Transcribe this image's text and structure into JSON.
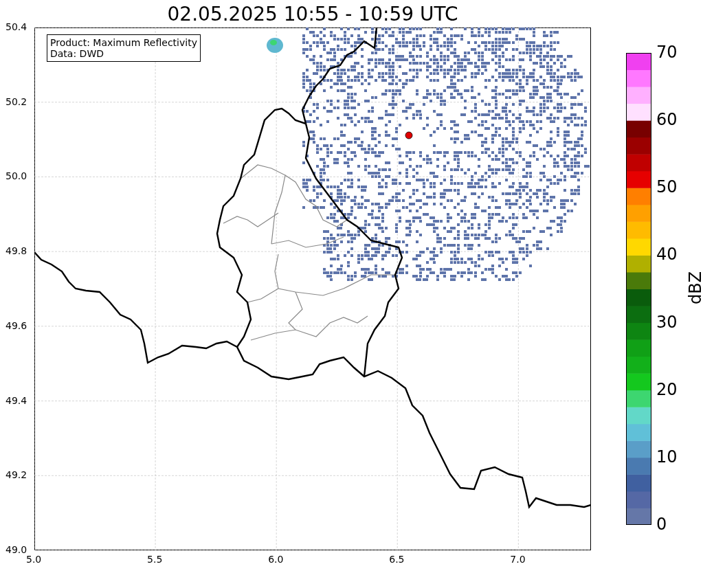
{
  "title": "02.05.2025 10:55 - 10:59 UTC",
  "info_box": {
    "lines": [
      "Product: Maximum Reflectivity",
      "Data: DWD"
    ]
  },
  "map": {
    "x_ticks": [
      "5.0",
      "5.5",
      "6.0",
      "6.5",
      "7.0"
    ],
    "y_ticks": [
      "50.4",
      "50.2",
      "50.0",
      "49.8",
      "49.6",
      "49.4",
      "49.2",
      "49.0"
    ]
  },
  "colorbar": {
    "label": "dBZ",
    "ticks": [
      "70",
      "60",
      "50",
      "40",
      "30",
      "20",
      "10",
      "0"
    ],
    "bins": [
      {
        "color": "#6577a8"
      },
      {
        "color": "#5568a5"
      },
      {
        "color": "#4060a0"
      },
      {
        "color": "#4a7ab0"
      },
      {
        "color": "#5a9ec8"
      },
      {
        "color": "#60c0d8"
      },
      {
        "color": "#62d8c8"
      },
      {
        "color": "#3dd670"
      },
      {
        "color": "#14c81e"
      },
      {
        "color": "#12b01a"
      },
      {
        "color": "#10a016"
      },
      {
        "color": "#0e8512"
      },
      {
        "color": "#0c6e10"
      },
      {
        "color": "#0a5c0c"
      },
      {
        "color": "#4a7a0a"
      },
      {
        "color": "#b0b000"
      },
      {
        "color": "#ffd800"
      },
      {
        "color": "#ffbb00"
      },
      {
        "color": "#ffa000"
      },
      {
        "color": "#ff7f00"
      },
      {
        "color": "#e60000"
      },
      {
        "color": "#c00000"
      },
      {
        "color": "#9b0000"
      },
      {
        "color": "#780000"
      },
      {
        "color": "#ffe0ff"
      },
      {
        "color": "#ffb0ff"
      },
      {
        "color": "#ff78ff"
      },
      {
        "color": "#f040f0"
      }
    ]
  }
}
